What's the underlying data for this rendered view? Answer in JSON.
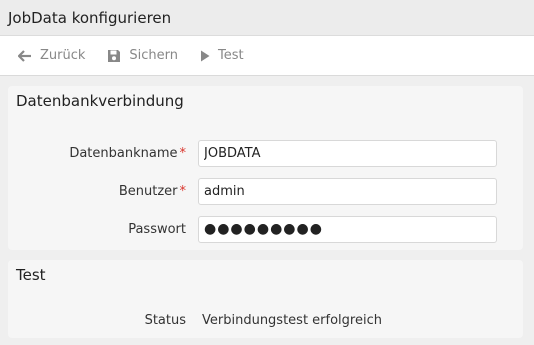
{
  "window": {
    "title": "JobData konfigurieren"
  },
  "toolbar": {
    "back_label": "Zurück",
    "save_label": "Sichern",
    "test_label": "Test",
    "icons": {
      "back": "arrow-left-icon",
      "save": "floppy-disk-icon",
      "test": "play-icon"
    },
    "icon_color": "#888888"
  },
  "db_panel": {
    "title": "Datenbankverbindung",
    "fields": {
      "dbname": {
        "label": "Datenbankname",
        "required": true,
        "value": "JOBDATA"
      },
      "user": {
        "label": "Benutzer",
        "required": true,
        "value": "admin"
      },
      "password": {
        "label": "Passwort",
        "required": false,
        "value": "●●●●●●●●●"
      }
    },
    "required_marker": "*",
    "required_color": "#d9342b"
  },
  "test_panel": {
    "title": "Test",
    "status_label": "Status",
    "status_value": "Verbindungstest erfolgreich"
  }
}
